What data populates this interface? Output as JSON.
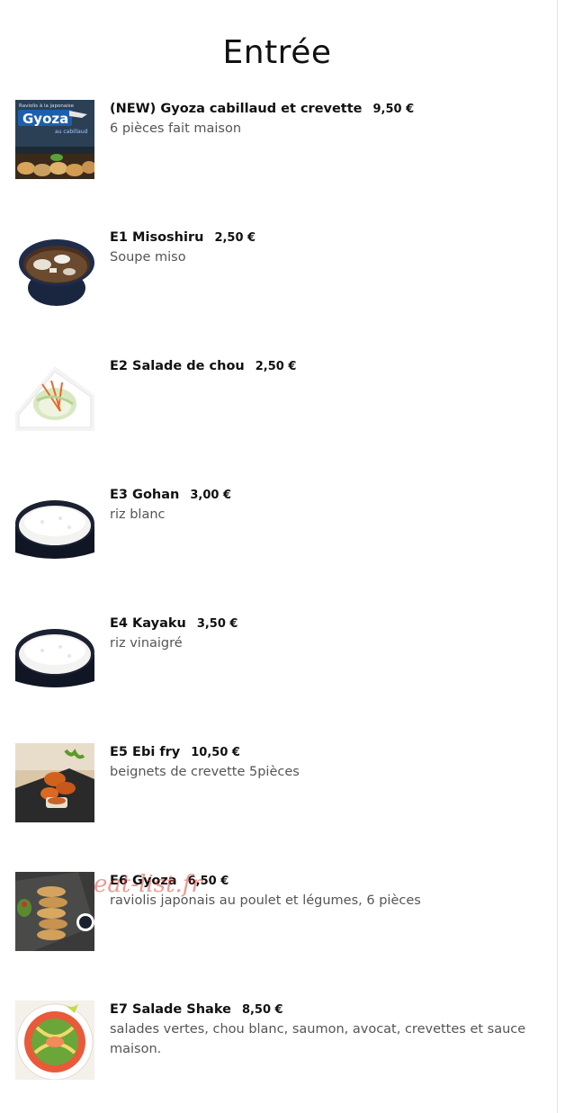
{
  "page": {
    "heading": "Entrée",
    "watermark": "eat-list.fr"
  },
  "items": [
    {
      "name": "(NEW) Gyoza cabillaud et crevette",
      "price": "9,50 €",
      "description": "6 pièces fait maison",
      "image": "gyoza-package-photo",
      "image_text": [
        "Raviolis à la japonaise",
        "Gyoza",
        "au cabillaud"
      ]
    },
    {
      "name": "E1 Misoshiru",
      "price": "2,50 €",
      "description": "Soupe miso",
      "image": "miso-soup-bowl-photo"
    },
    {
      "name": "E2 Salade de chou",
      "price": "2,50 €",
      "description": "",
      "image": "cabbage-salad-plate-photo"
    },
    {
      "name": "E3 Gohan",
      "price": "3,00 €",
      "description": "riz blanc",
      "image": "rice-bowl-photo"
    },
    {
      "name": "E4 Kayaku",
      "price": "3,50 €",
      "description": "riz vinaigré",
      "image": "rice-bowl-photo"
    },
    {
      "name": "E5 Ebi fry",
      "price": "10,50 €",
      "description": "beignets de crevette 5pièces",
      "image": "fried-shrimp-photo"
    },
    {
      "name": "E6 Gyoza",
      "price": "6,50 €",
      "description": "raviolis japonais au poulet et légumes, 6 pièces",
      "image": "gyoza-plate-photo"
    },
    {
      "name": "E7 Salade Shake",
      "price": "8,50 €",
      "description": "salades vertes, chou blanc, saumon, avocat, crevettes et sauce maison.",
      "image": "salmon-salad-plate-photo"
    }
  ]
}
